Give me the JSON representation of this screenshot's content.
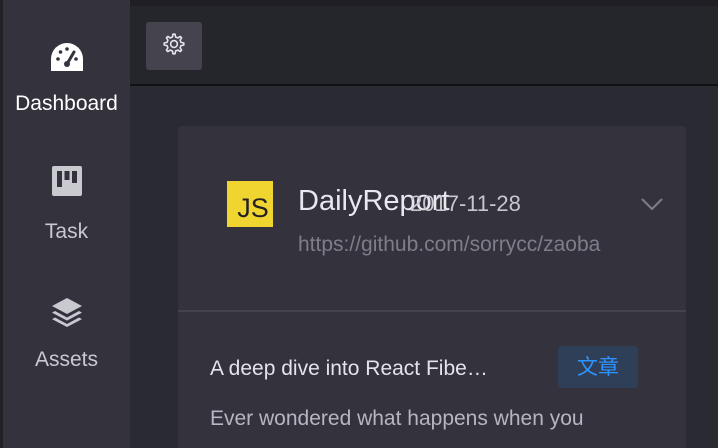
{
  "sidebar": {
    "items": [
      {
        "label": "Dashboard",
        "icon": "dashboard-gauge-icon",
        "active": true
      },
      {
        "label": "Task",
        "icon": "kanban-board-icon",
        "active": false
      },
      {
        "label": "Assets",
        "icon": "layers-icon",
        "active": false
      }
    ]
  },
  "header": {
    "settings_icon": "gear-icon"
  },
  "card": {
    "repo_logo_text": "JS",
    "repo_name": "DailyReport",
    "repo_date": "2017-11-28",
    "repo_url": "https://github.com/sorrycc/zaoba",
    "article_title": "A deep dive into React Fibe…",
    "article_tag": "文章",
    "article_desc": "Ever wondered what happens when you"
  },
  "colors": {
    "background": "#2a2a33",
    "sidebar": "#33323d",
    "header": "#25252c",
    "card": "#33323d",
    "accent_tag_text": "#2f94ff",
    "accent_tag_bg": "#2e3f57",
    "js_logo": "#f0d531"
  }
}
